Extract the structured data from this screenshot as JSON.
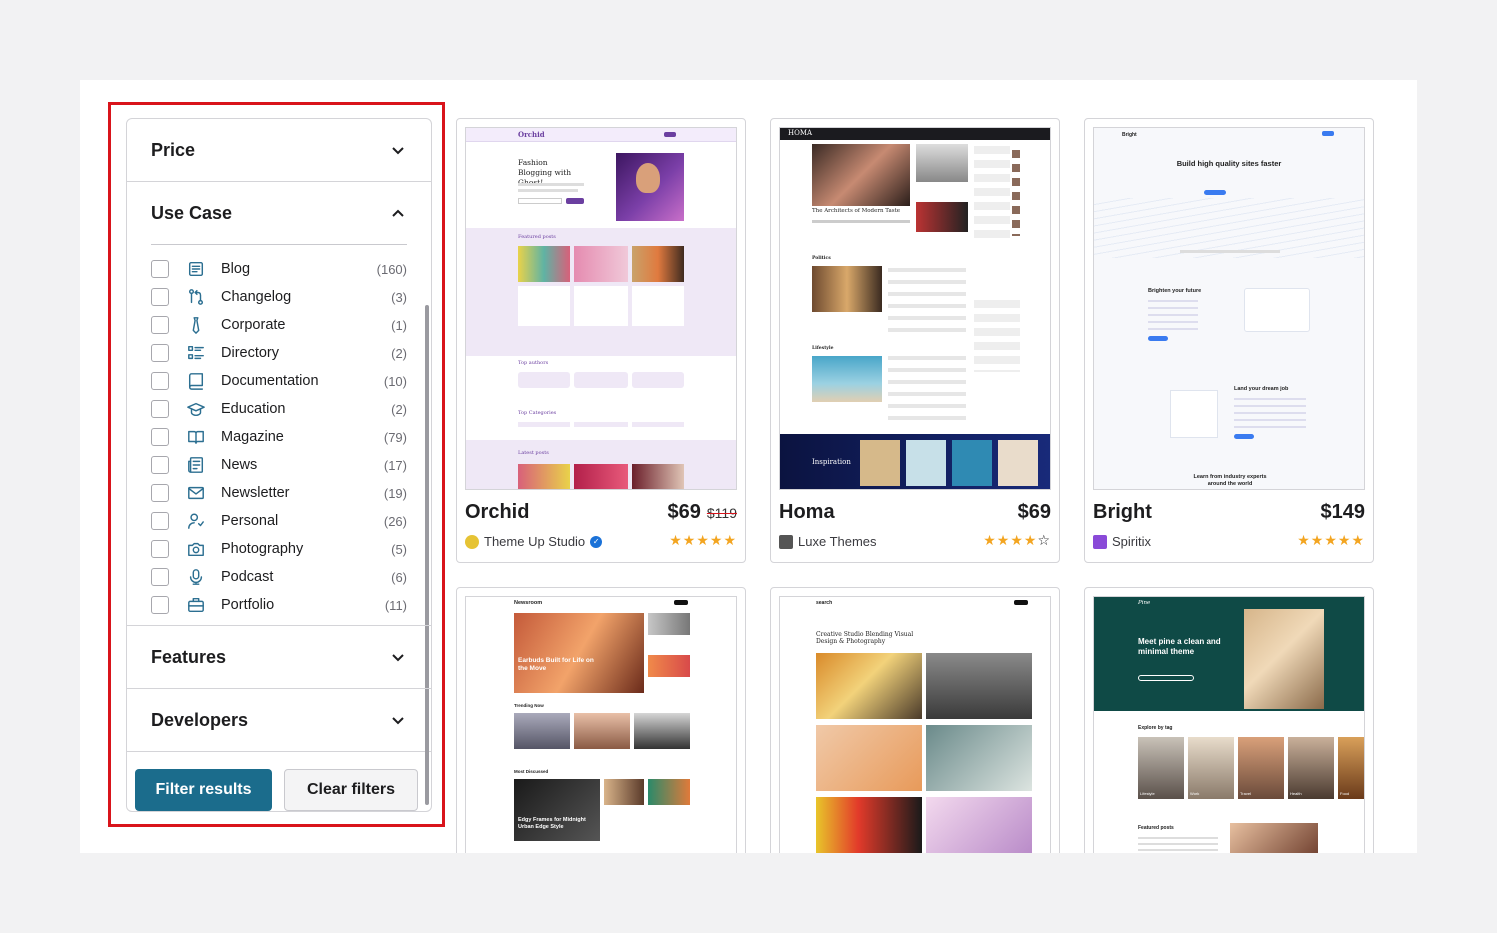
{
  "filters": {
    "price": {
      "title": "Price"
    },
    "use_case": {
      "title": "Use Case",
      "options": [
        {
          "label": "Blog",
          "count": "(160)",
          "icon": "blog-icon"
        },
        {
          "label": "Changelog",
          "count": "(3)",
          "icon": "changelog-icon"
        },
        {
          "label": "Corporate",
          "count": "(1)",
          "icon": "corporate-icon"
        },
        {
          "label": "Directory",
          "count": "(2)",
          "icon": "directory-icon"
        },
        {
          "label": "Documentation",
          "count": "(10)",
          "icon": "documentation-icon"
        },
        {
          "label": "Education",
          "count": "(2)",
          "icon": "education-icon"
        },
        {
          "label": "Magazine",
          "count": "(79)",
          "icon": "magazine-icon"
        },
        {
          "label": "News",
          "count": "(17)",
          "icon": "news-icon"
        },
        {
          "label": "Newsletter",
          "count": "(19)",
          "icon": "newsletter-icon"
        },
        {
          "label": "Personal",
          "count": "(26)",
          "icon": "personal-icon"
        },
        {
          "label": "Photography",
          "count": "(5)",
          "icon": "photography-icon"
        },
        {
          "label": "Podcast",
          "count": "(6)",
          "icon": "podcast-icon"
        },
        {
          "label": "Portfolio",
          "count": "(11)",
          "icon": "portfolio-icon"
        }
      ]
    },
    "features": {
      "title": "Features"
    },
    "developers": {
      "title": "Developers"
    },
    "filter_button": "Filter results",
    "clear_button": "Clear filters"
  },
  "themes": [
    {
      "name": "Orchid",
      "price": "$69",
      "old_price": "$119",
      "author": "Theme Up Studio",
      "rating": 5
    },
    {
      "name": "Homa",
      "price": "$69",
      "author": "Luxe Themes",
      "rating": 4
    },
    {
      "name": "Bright",
      "price": "$149",
      "author": "Spiritix",
      "rating": 5
    }
  ],
  "previews": {
    "orchid": {
      "brand": "Orchid",
      "headline": "Fashion Blogging with Ghost!",
      "featured": "Featured posts",
      "authors": "Top authors",
      "categories": "Top Categories",
      "latest": "Latest posts"
    },
    "homa": {
      "brand": "HOMA",
      "headline": "The Architects of Modern Taste",
      "politics": "Politics",
      "lifestyle": "Lifestyle",
      "inspiration": "Inspiration"
    },
    "bright": {
      "brand": "Bright",
      "headline": "Build high quality sites faster",
      "section1": "Brighten your future",
      "section2": "Land your dream job",
      "section3": "Learn from industry experts around the world"
    },
    "newsroom": {
      "brand": "Newsroom",
      "hero": "Earbuds Built for Life on the Move",
      "trending": "Trending Now",
      "most": "Most Discussed",
      "edgy": "Edgy Frames for Midnight Urban Edge Style"
    },
    "search": {
      "brand": "search",
      "headline": "Creative Studio Blending Visual Design & Photography"
    },
    "pine": {
      "brand": "Pine",
      "headline": "Meet pine a clean and minimal theme",
      "explore": "Explore by tag",
      "featured": "Featured posts",
      "tags": [
        "Lifestyle",
        "Work",
        "Travel",
        "Health",
        "Food"
      ]
    }
  },
  "colors": {
    "accent": "#1b6c8c",
    "highlight": "#d9141b",
    "star": "#f3a521"
  }
}
